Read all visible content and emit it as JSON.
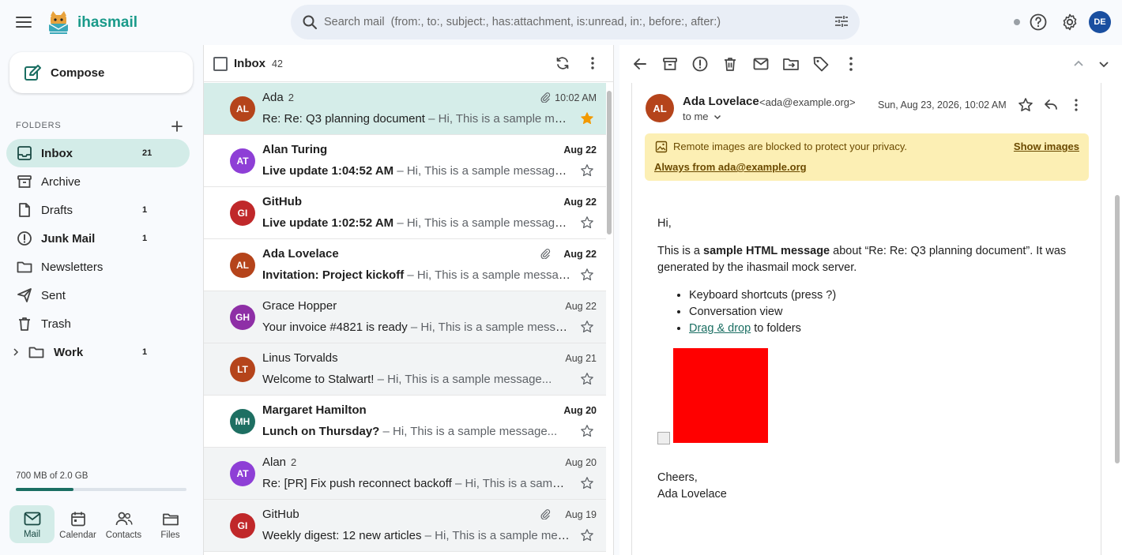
{
  "app": {
    "name": "ihasmail"
  },
  "search": {
    "placeholder": "Search mail  (from:, to:, subject:, has:attachment, is:unread, in:, before:, after:)"
  },
  "user": {
    "initials": "DE",
    "avatar_color": "#1a4fa0"
  },
  "sidebar": {
    "compose_label": "Compose",
    "folders_header": "FOLDERS",
    "folders": [
      {
        "name": "Inbox",
        "count": "21",
        "icon": "inbox-icon",
        "active": true
      },
      {
        "name": "Archive",
        "count": "",
        "icon": "archive-icon"
      },
      {
        "name": "Drafts",
        "count": "1",
        "icon": "draft-icon"
      },
      {
        "name": "Junk Mail",
        "count": "1",
        "icon": "junk-icon",
        "bold": true
      },
      {
        "name": "Newsletters",
        "count": "",
        "icon": "folder-icon"
      },
      {
        "name": "Sent",
        "count": "",
        "icon": "send-icon"
      },
      {
        "name": "Trash",
        "count": "",
        "icon": "trash-icon"
      },
      {
        "name": "Work",
        "count": "1",
        "icon": "folder-icon",
        "bold": true
      }
    ],
    "storage_text": "700 MB of 2.0 GB",
    "storage_fraction": 0.34,
    "apps": [
      {
        "label": "Mail",
        "icon": "mail-icon",
        "active": true
      },
      {
        "label": "Calendar",
        "icon": "calendar-icon"
      },
      {
        "label": "Contacts",
        "icon": "contacts-icon"
      },
      {
        "label": "Files",
        "icon": "files-icon"
      }
    ]
  },
  "list": {
    "title": "Inbox",
    "count": "42",
    "rows": [
      {
        "initials": "AL",
        "color": "#b5441b",
        "sender": "Ada",
        "thread": "2",
        "subject": "Re: Re: Q3 planning document",
        "snippet": "– Hi, This is a sample mes...",
        "date": "10:02 AM",
        "attachment": true,
        "starred": true,
        "unread": false,
        "selected": true
      },
      {
        "initials": "AT",
        "color": "#8e3fd6",
        "sender": "Alan Turing",
        "thread": "",
        "subject": "Live update 1:04:52 AM",
        "snippet": "– Hi, This is a sample message...",
        "date": "Aug 22",
        "attachment": false,
        "starred": false,
        "unread": true
      },
      {
        "initials": "GI",
        "color": "#c0282a",
        "sender": "GitHub",
        "thread": "",
        "subject": "Live update 1:02:52 AM",
        "snippet": "– Hi, This is a sample message...",
        "date": "Aug 22",
        "attachment": false,
        "starred": false,
        "unread": true
      },
      {
        "initials": "AL",
        "color": "#b5441b",
        "sender": "Ada Lovelace",
        "thread": "",
        "subject": "Invitation: Project kickoff",
        "snippet": "– Hi, This is a sample message...",
        "date": "Aug 22",
        "attachment": true,
        "starred": false,
        "unread": true
      },
      {
        "initials": "GH",
        "color": "#8e2fa6",
        "sender": "Grace Hopper",
        "thread": "",
        "subject": "Your invoice #4821 is ready",
        "snippet": "– Hi, This is a sample messa...",
        "date": "Aug 22",
        "attachment": false,
        "starred": false,
        "unread": false
      },
      {
        "initials": "LT",
        "color": "#b5441b",
        "sender": "Linus Torvalds",
        "thread": "",
        "subject": "Welcome to Stalwart!",
        "snippet": "– Hi, This is a sample message...",
        "date": "Aug 21",
        "attachment": false,
        "starred": false,
        "unread": false
      },
      {
        "initials": "MH",
        "color": "#1e6f62",
        "sender": "Margaret Hamilton",
        "thread": "",
        "subject": "Lunch on Thursday?",
        "snippet": "– Hi, This is a sample message...",
        "date": "Aug 20",
        "attachment": false,
        "starred": false,
        "unread": true
      },
      {
        "initials": "AT",
        "color": "#8e3fd6",
        "sender": "Alan",
        "thread": "2",
        "subject": "Re: [PR] Fix push reconnect backoff",
        "snippet": "– Hi, This is a sampl...",
        "date": "Aug 20",
        "attachment": false,
        "starred": false,
        "unread": false
      },
      {
        "initials": "GI",
        "color": "#c0282a",
        "sender": "GitHub",
        "thread": "",
        "subject": "Weekly digest: 12 new articles",
        "snippet": "– Hi, This is a sample mes...",
        "date": "Aug 19",
        "attachment": true,
        "starred": false,
        "unread": false
      }
    ]
  },
  "message": {
    "initials": "AL",
    "from_name": "Ada Lovelace",
    "from_email": "<ada@example.org>",
    "to": "to me",
    "date": "Sun, Aug 23, 2026, 10:02 AM",
    "banner_text": "Remote images are blocked to protect your privacy.",
    "show_images": "Show images",
    "always_from": "Always from ada@example.org",
    "greeting": "Hi,",
    "para_prefix": "This is a ",
    "para_bold": "sample HTML message",
    "para_suffix": " about “Re: Re: Q3 planning document”. It was generated by the ihasmail mock server.",
    "bullet1": "Keyboard shortcuts (press ?)",
    "bullet2": "Conversation view",
    "bullet3_link": "Drag & drop",
    "bullet3_rest": " to folders",
    "sign_off": "Cheers,",
    "signature": "Ada Lovelace"
  }
}
